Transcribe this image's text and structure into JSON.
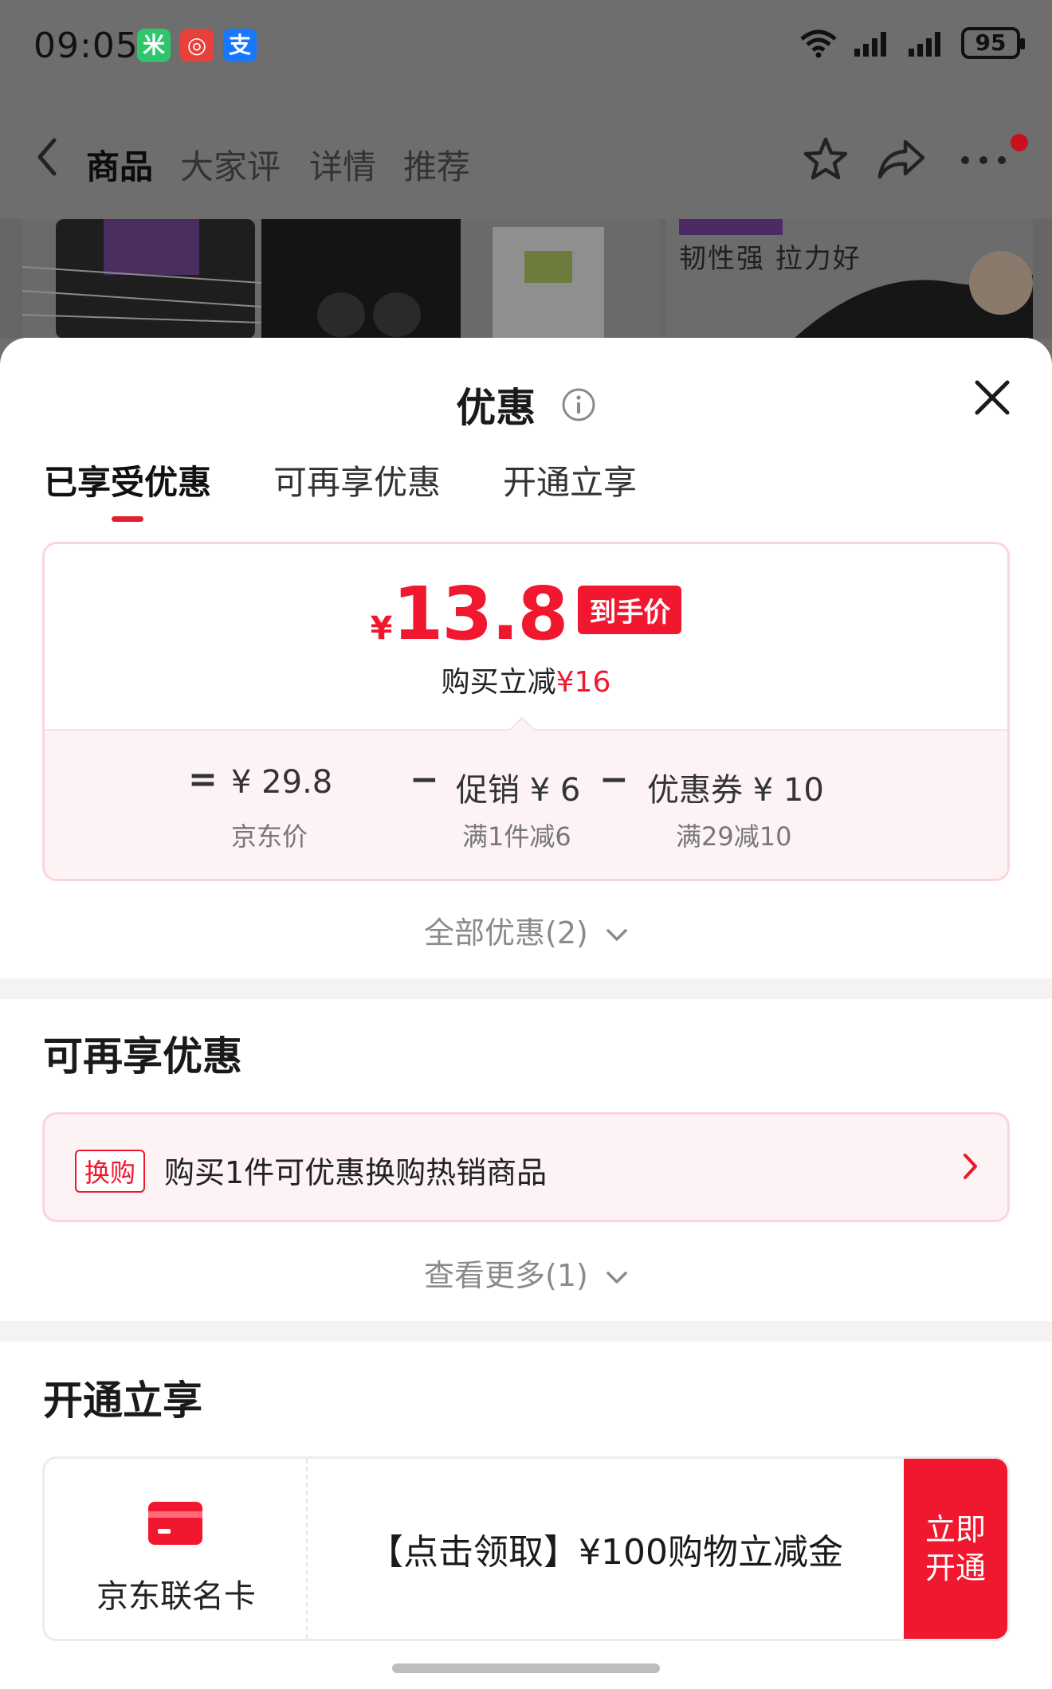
{
  "status_bar": {
    "time": "09:05",
    "apps": [
      {
        "icon": "mi-home-icon",
        "color": "#2fc56b",
        "glyph": "米"
      },
      {
        "icon": "app-icon",
        "color": "#e8403a",
        "glyph": "◎"
      },
      {
        "icon": "alipay-icon",
        "color": "#1677ff",
        "glyph": "支"
      }
    ],
    "battery": "95"
  },
  "nav": {
    "tabs": [
      "商品",
      "大家评",
      "详情",
      "推荐"
    ]
  },
  "product": {
    "caption": "韧性强  拉力好"
  },
  "sheet": {
    "title": "优惠",
    "tabs": [
      "已享受优惠",
      "可再享优惠",
      "开通立享"
    ],
    "price": {
      "yen": "¥",
      "value": "13.8",
      "badge": "到手价",
      "save_prefix": "购买立减",
      "save_amount": "¥16"
    },
    "formula": {
      "eq": "=",
      "minus": "−",
      "base_value": "¥ 29.8",
      "base_label": "京东价",
      "promo_value": "促销 ¥ 6",
      "promo_label": "满1件减6",
      "coupon_value": "优惠券 ¥ 10",
      "coupon_label": "满29减10"
    },
    "all_offers": "全部优惠(2)",
    "more_section": {
      "title": "可再享优惠",
      "tag": "换购",
      "text": "购买1件可优惠换购热销商品",
      "see_more": "查看更多(1)"
    },
    "open_section": {
      "title": "开通立享",
      "card_label": "京东联名卡",
      "offer_text": "【点击领取】¥100购物立减金",
      "button": "立即\n开通"
    }
  },
  "colors": {
    "accent": "#f0172e",
    "pink_bg": "#fdf3f5",
    "pink_border": "#fbd5dc"
  }
}
